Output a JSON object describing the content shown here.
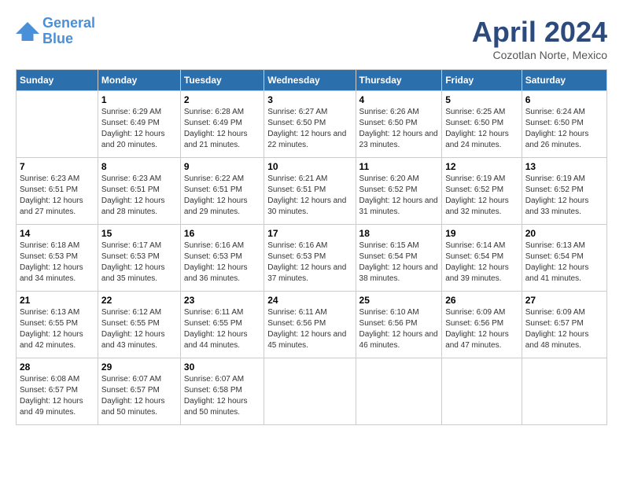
{
  "logo": {
    "line1": "General",
    "line2": "Blue"
  },
  "title": "April 2024",
  "subtitle": "Cozotlan Norte, Mexico",
  "days_of_week": [
    "Sunday",
    "Monday",
    "Tuesday",
    "Wednesday",
    "Thursday",
    "Friday",
    "Saturday"
  ],
  "weeks": [
    [
      {
        "day": "",
        "empty": true
      },
      {
        "day": "1",
        "sunrise": "Sunrise: 6:29 AM",
        "sunset": "Sunset: 6:49 PM",
        "daylight": "Daylight: 12 hours and 20 minutes."
      },
      {
        "day": "2",
        "sunrise": "Sunrise: 6:28 AM",
        "sunset": "Sunset: 6:49 PM",
        "daylight": "Daylight: 12 hours and 21 minutes."
      },
      {
        "day": "3",
        "sunrise": "Sunrise: 6:27 AM",
        "sunset": "Sunset: 6:50 PM",
        "daylight": "Daylight: 12 hours and 22 minutes."
      },
      {
        "day": "4",
        "sunrise": "Sunrise: 6:26 AM",
        "sunset": "Sunset: 6:50 PM",
        "daylight": "Daylight: 12 hours and 23 minutes."
      },
      {
        "day": "5",
        "sunrise": "Sunrise: 6:25 AM",
        "sunset": "Sunset: 6:50 PM",
        "daylight": "Daylight: 12 hours and 24 minutes."
      },
      {
        "day": "6",
        "sunrise": "Sunrise: 6:24 AM",
        "sunset": "Sunset: 6:50 PM",
        "daylight": "Daylight: 12 hours and 26 minutes."
      }
    ],
    [
      {
        "day": "7",
        "sunrise": "Sunrise: 6:23 AM",
        "sunset": "Sunset: 6:51 PM",
        "daylight": "Daylight: 12 hours and 27 minutes."
      },
      {
        "day": "8",
        "sunrise": "Sunrise: 6:23 AM",
        "sunset": "Sunset: 6:51 PM",
        "daylight": "Daylight: 12 hours and 28 minutes."
      },
      {
        "day": "9",
        "sunrise": "Sunrise: 6:22 AM",
        "sunset": "Sunset: 6:51 PM",
        "daylight": "Daylight: 12 hours and 29 minutes."
      },
      {
        "day": "10",
        "sunrise": "Sunrise: 6:21 AM",
        "sunset": "Sunset: 6:51 PM",
        "daylight": "Daylight: 12 hours and 30 minutes."
      },
      {
        "day": "11",
        "sunrise": "Sunrise: 6:20 AM",
        "sunset": "Sunset: 6:52 PM",
        "daylight": "Daylight: 12 hours and 31 minutes."
      },
      {
        "day": "12",
        "sunrise": "Sunrise: 6:19 AM",
        "sunset": "Sunset: 6:52 PM",
        "daylight": "Daylight: 12 hours and 32 minutes."
      },
      {
        "day": "13",
        "sunrise": "Sunrise: 6:19 AM",
        "sunset": "Sunset: 6:52 PM",
        "daylight": "Daylight: 12 hours and 33 minutes."
      }
    ],
    [
      {
        "day": "14",
        "sunrise": "Sunrise: 6:18 AM",
        "sunset": "Sunset: 6:53 PM",
        "daylight": "Daylight: 12 hours and 34 minutes."
      },
      {
        "day": "15",
        "sunrise": "Sunrise: 6:17 AM",
        "sunset": "Sunset: 6:53 PM",
        "daylight": "Daylight: 12 hours and 35 minutes."
      },
      {
        "day": "16",
        "sunrise": "Sunrise: 6:16 AM",
        "sunset": "Sunset: 6:53 PM",
        "daylight": "Daylight: 12 hours and 36 minutes."
      },
      {
        "day": "17",
        "sunrise": "Sunrise: 6:16 AM",
        "sunset": "Sunset: 6:53 PM",
        "daylight": "Daylight: 12 hours and 37 minutes."
      },
      {
        "day": "18",
        "sunrise": "Sunrise: 6:15 AM",
        "sunset": "Sunset: 6:54 PM",
        "daylight": "Daylight: 12 hours and 38 minutes."
      },
      {
        "day": "19",
        "sunrise": "Sunrise: 6:14 AM",
        "sunset": "Sunset: 6:54 PM",
        "daylight": "Daylight: 12 hours and 39 minutes."
      },
      {
        "day": "20",
        "sunrise": "Sunrise: 6:13 AM",
        "sunset": "Sunset: 6:54 PM",
        "daylight": "Daylight: 12 hours and 41 minutes."
      }
    ],
    [
      {
        "day": "21",
        "sunrise": "Sunrise: 6:13 AM",
        "sunset": "Sunset: 6:55 PM",
        "daylight": "Daylight: 12 hours and 42 minutes."
      },
      {
        "day": "22",
        "sunrise": "Sunrise: 6:12 AM",
        "sunset": "Sunset: 6:55 PM",
        "daylight": "Daylight: 12 hours and 43 minutes."
      },
      {
        "day": "23",
        "sunrise": "Sunrise: 6:11 AM",
        "sunset": "Sunset: 6:55 PM",
        "daylight": "Daylight: 12 hours and 44 minutes."
      },
      {
        "day": "24",
        "sunrise": "Sunrise: 6:11 AM",
        "sunset": "Sunset: 6:56 PM",
        "daylight": "Daylight: 12 hours and 45 minutes."
      },
      {
        "day": "25",
        "sunrise": "Sunrise: 6:10 AM",
        "sunset": "Sunset: 6:56 PM",
        "daylight": "Daylight: 12 hours and 46 minutes."
      },
      {
        "day": "26",
        "sunrise": "Sunrise: 6:09 AM",
        "sunset": "Sunset: 6:56 PM",
        "daylight": "Daylight: 12 hours and 47 minutes."
      },
      {
        "day": "27",
        "sunrise": "Sunrise: 6:09 AM",
        "sunset": "Sunset: 6:57 PM",
        "daylight": "Daylight: 12 hours and 48 minutes."
      }
    ],
    [
      {
        "day": "28",
        "sunrise": "Sunrise: 6:08 AM",
        "sunset": "Sunset: 6:57 PM",
        "daylight": "Daylight: 12 hours and 49 minutes."
      },
      {
        "day": "29",
        "sunrise": "Sunrise: 6:07 AM",
        "sunset": "Sunset: 6:57 PM",
        "daylight": "Daylight: 12 hours and 50 minutes."
      },
      {
        "day": "30",
        "sunrise": "Sunrise: 6:07 AM",
        "sunset": "Sunset: 6:58 PM",
        "daylight": "Daylight: 12 hours and 50 minutes."
      },
      {
        "day": "",
        "empty": true
      },
      {
        "day": "",
        "empty": true
      },
      {
        "day": "",
        "empty": true
      },
      {
        "day": "",
        "empty": true
      }
    ]
  ]
}
